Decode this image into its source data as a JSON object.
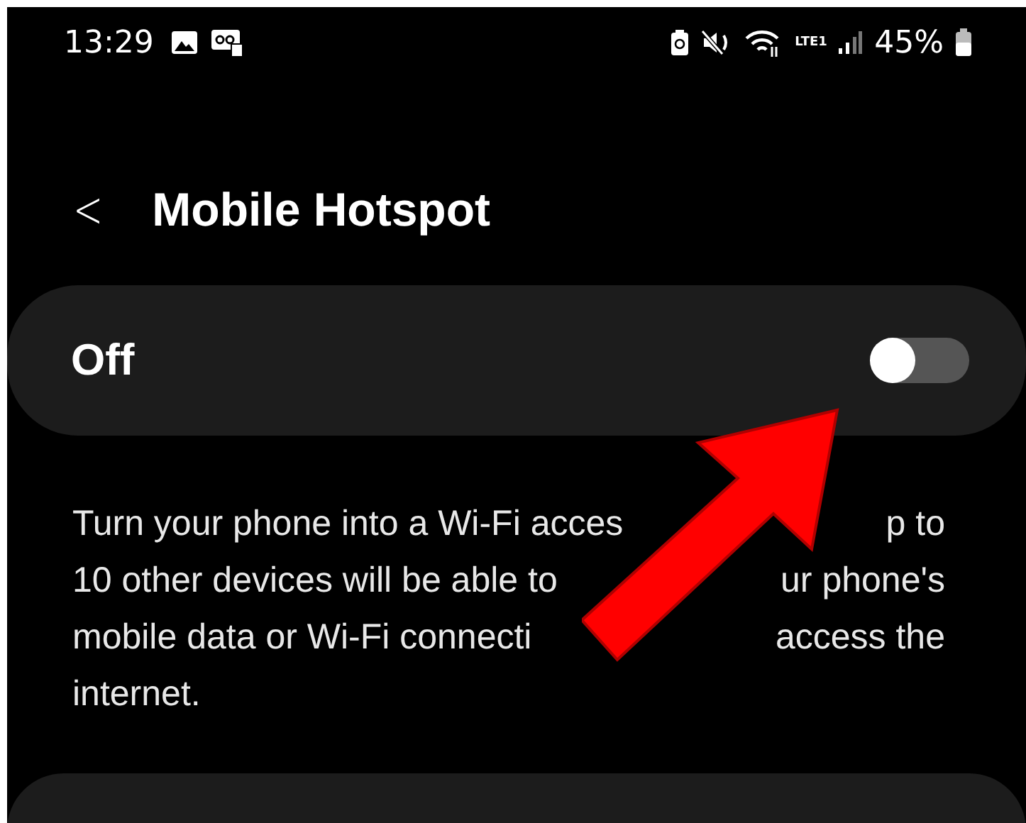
{
  "status_bar": {
    "time": "13:29",
    "battery_percent": "45%",
    "network": "LTE1"
  },
  "header": {
    "back": "<",
    "title": "Mobile Hotspot"
  },
  "master_switch": {
    "label": "Off",
    "on": false
  },
  "description_lines": [
    [
      "Turn your phone into a Wi-Fi acces",
      "p to"
    ],
    [
      "10 other devices will be able to",
      "ur phone's"
    ],
    [
      "mobile data or Wi-Fi connecti",
      "access the"
    ],
    [
      "internet."
    ]
  ]
}
